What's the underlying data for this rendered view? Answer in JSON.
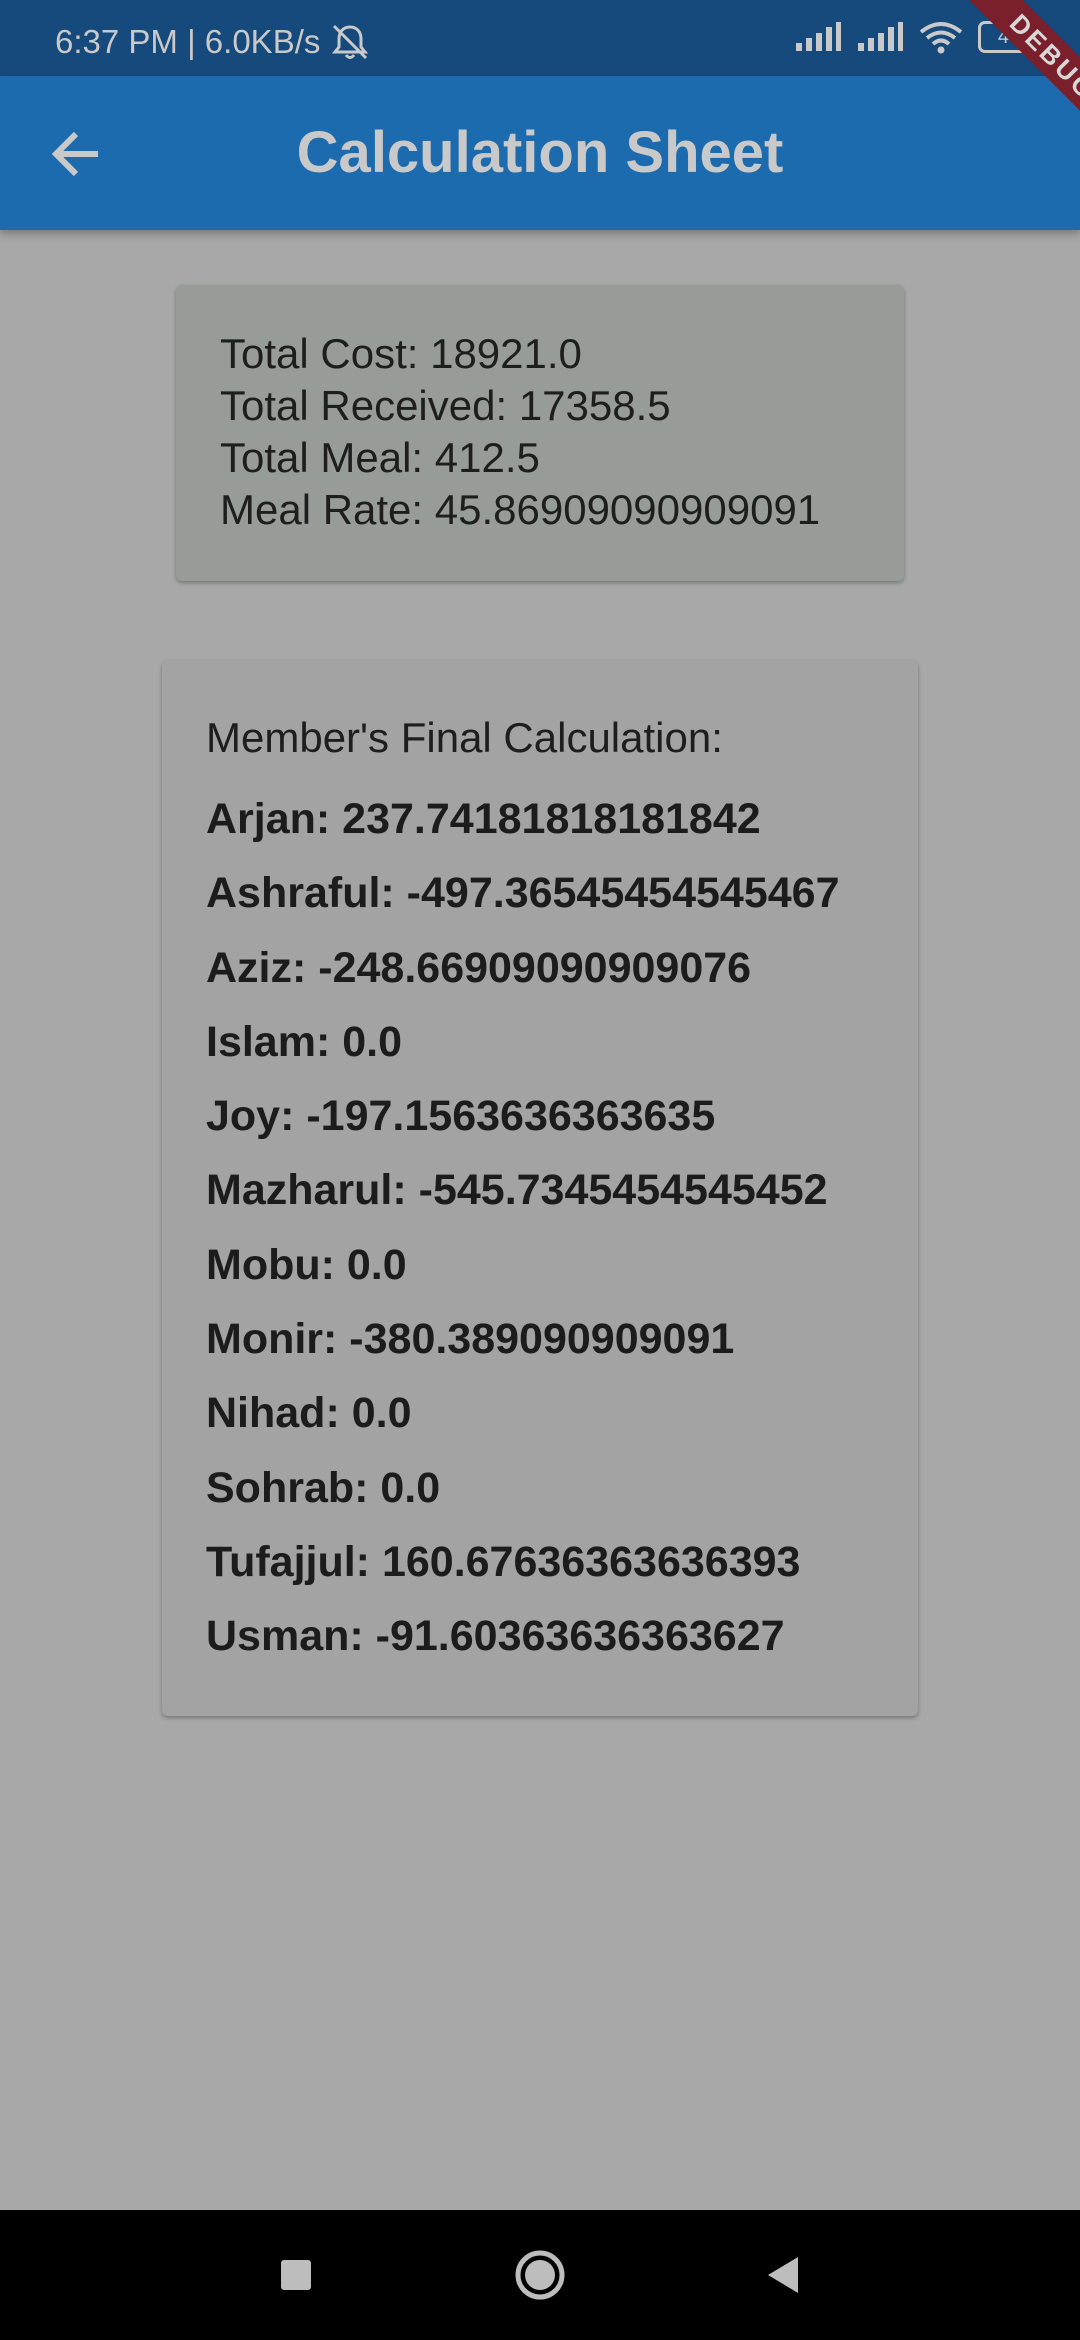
{
  "status_bar": {
    "time_speed": "6:37 PM | 6.0KB/s",
    "battery": "44",
    "icons": [
      "mute-notifications-icon",
      "signal-icon",
      "signal-icon",
      "wifi-icon",
      "battery-icon"
    ]
  },
  "app_bar": {
    "title": "Calculation Sheet",
    "back_icon": "back-arrow-icon"
  },
  "debug_banner": "DEBUG",
  "summary": {
    "total_cost": "Total Cost: 18921.0",
    "total_received": "Total Received: 17358.5",
    "total_meal": "Total Meal: 412.5",
    "meal_rate": "Meal Rate: 45.86909090909091"
  },
  "members": {
    "heading": "Member's Final Calculation:",
    "rows": [
      "Arjan: 237.74181818181842",
      "Ashraful: -497.36545454545467",
      "Aziz: -248.66909090909076",
      "Islam: 0.0",
      "Joy: -197.1563636363635",
      "Mazharul: -545.7345454545452",
      "Mobu: 0.0",
      "Monir: -380.389090909091",
      "Nihad: 0.0",
      "Sohrab: 0.0",
      "Tufajjul: 160.67636363636393",
      "Usman: -91.60363636363627"
    ]
  },
  "nav_bar": {
    "icons": [
      "recents-icon",
      "home-icon",
      "back-icon"
    ]
  },
  "colors": {
    "status_bar": "#16497c",
    "app_bar": "#1c6bae",
    "background": "#a8a8a8",
    "summary_card": "#979c98",
    "members_card": "#a2a3a2",
    "debug_ribbon": "#7a1f2c"
  }
}
